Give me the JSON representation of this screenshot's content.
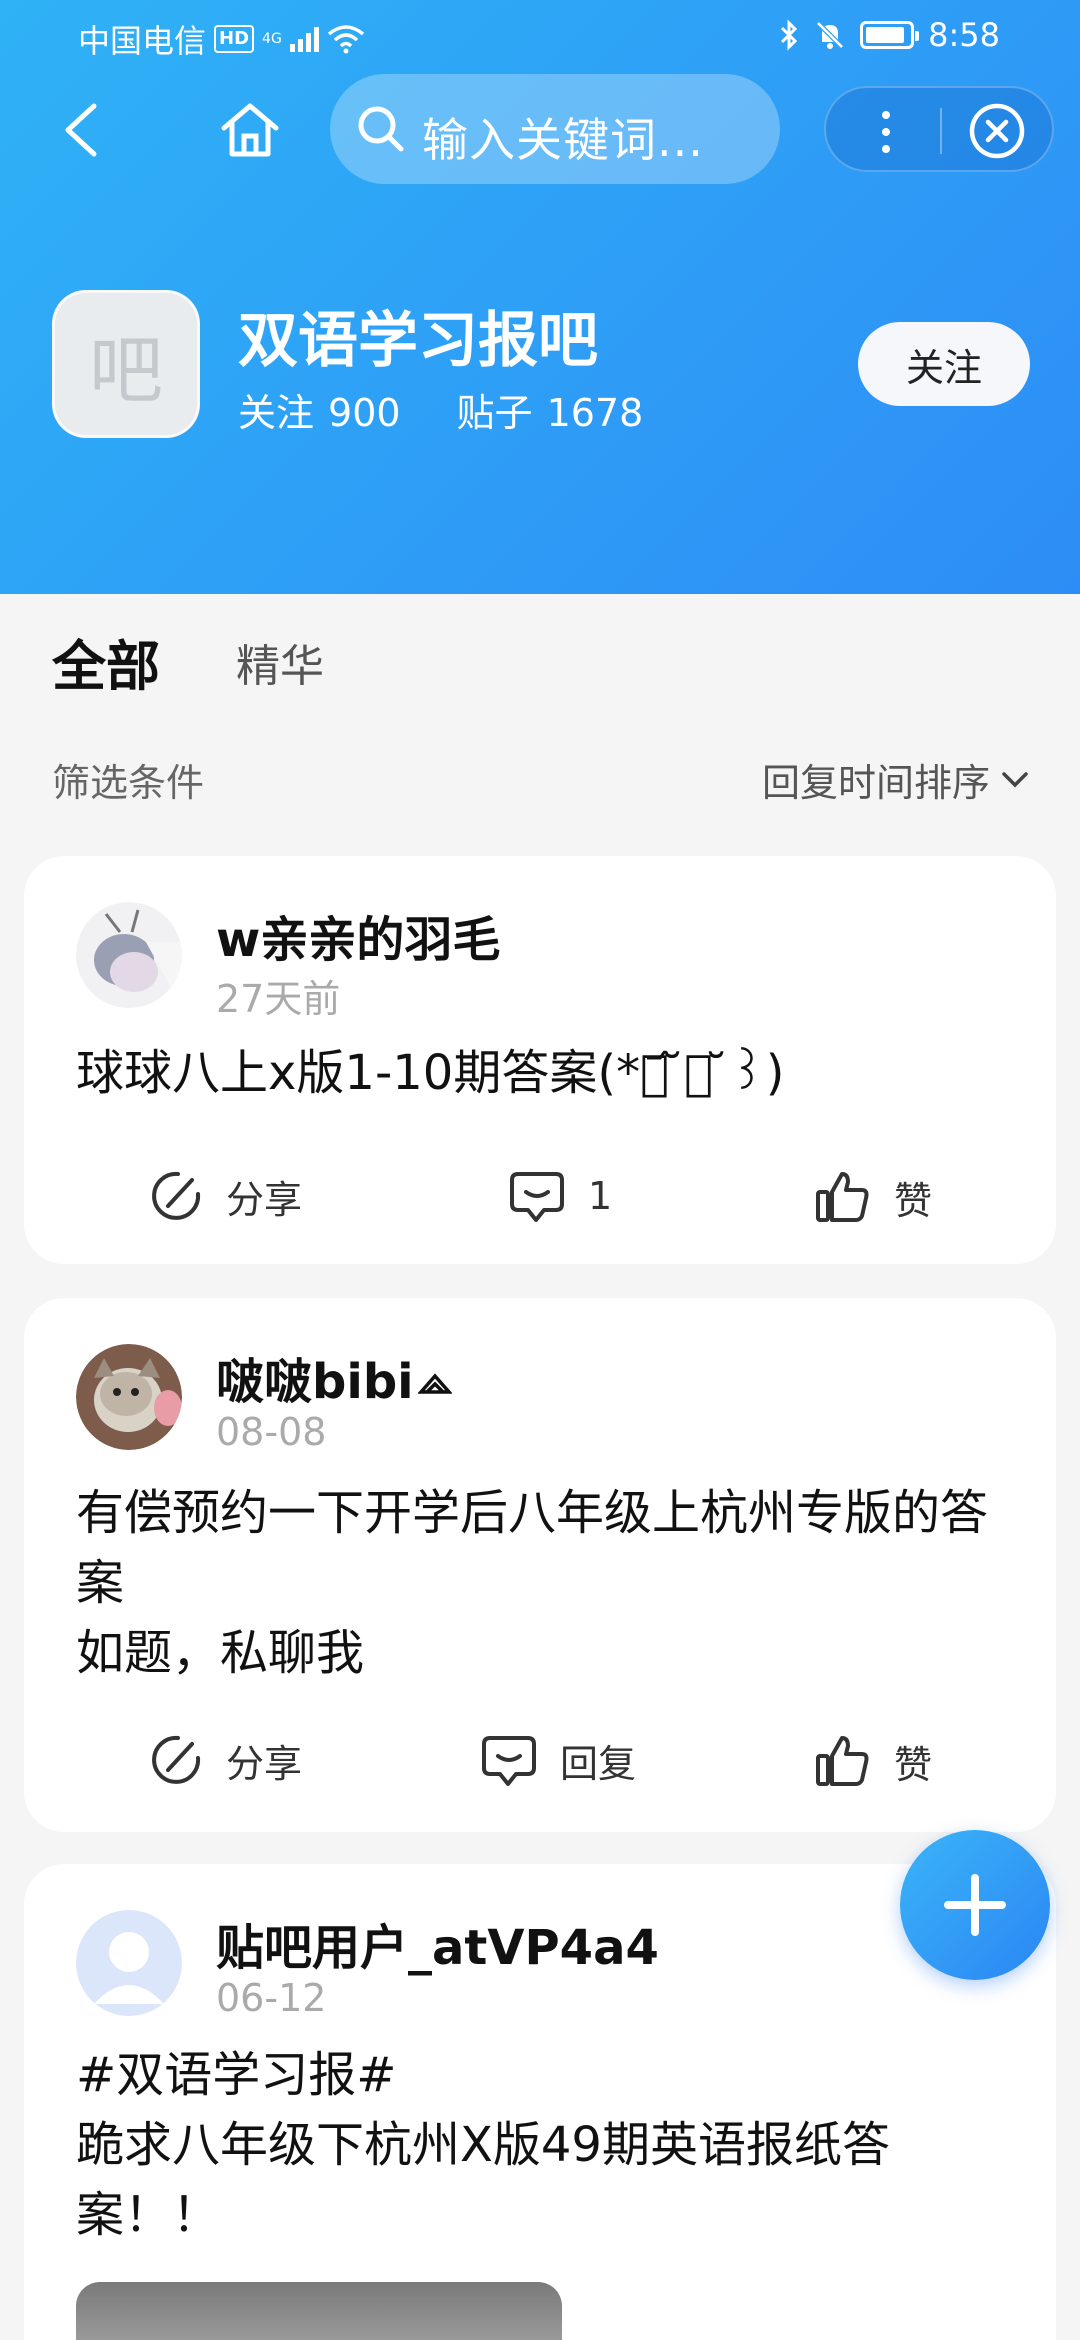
{
  "status_bar": {
    "carrier": "中国电信",
    "hd": "HD",
    "net": "4G",
    "time": "8:58"
  },
  "nav": {
    "search_placeholder": "输入关键词..."
  },
  "forum": {
    "avatar_char": "吧",
    "name": "双语学习报吧",
    "follow_label": "关注",
    "follow_count": "900",
    "post_label": "贴子",
    "post_count": "1678",
    "follow_button": "关注"
  },
  "tabs": {
    "all": "全部",
    "best": "精华"
  },
  "filter": {
    "label": "筛选条件",
    "sort": "回复时间排序"
  },
  "posts": [
    {
      "user": "w亲亲的羽毛",
      "time": "27天前",
      "text": "球球八上x版1-10期答案(*꒰᷄ ̆⌓ ̆꒱)",
      "share": "分享",
      "reply": "1",
      "like": "赞"
    },
    {
      "user": "啵啵bibi",
      "time": "08-08",
      "text": "有偿预约一下开学后八年级上杭州专版的答案\n如题，私聊我",
      "share": "分享",
      "reply": "回复",
      "like": "赞"
    },
    {
      "user": "贴吧用户_atVP4a4",
      "time": "06-12",
      "text": "#双语学习报#\n跪求八年级下杭州X版49期英语报纸答案！！"
    }
  ],
  "colors": {
    "header_start": "#2fb2f6",
    "header_end": "#2d8df6",
    "fab": "#2a86f4"
  }
}
